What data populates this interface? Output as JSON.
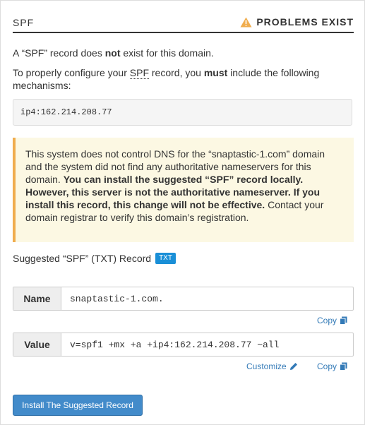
{
  "header": {
    "title": "SPF",
    "status": "PROBLEMS EXIST"
  },
  "intro": {
    "part1": "A “SPF” record does ",
    "bold": "not",
    "part2": " exist for this domain."
  },
  "instruction": {
    "part1": "To properly configure your ",
    "spf": "SPF",
    "part2": " record, you ",
    "bold": "must",
    "part3": " include the following mechanisms:"
  },
  "mechanisms": "ip4:162.214.208.77",
  "alert": {
    "part1": "This system does not control DNS for the “snaptastic-1.com” domain and the system did not find any authoritative nameservers for this domain. ",
    "bold": "You can install the suggested “SPF” record locally. However, this server is not the authoritative nameserver. If you install this record, this change will not be effective.",
    "part2": " Contact your domain registrar to verify this domain’s registration."
  },
  "suggested": {
    "label": "Suggested “SPF” (TXT) Record",
    "badge": "TXT"
  },
  "name_field": {
    "label": "Name",
    "value": "snaptastic-1.com."
  },
  "value_field": {
    "label": "Value",
    "value": "v=spf1 +mx +a +ip4:162.214.208.77 ~all"
  },
  "links": {
    "copy_name": "Copy",
    "customize": "Customize",
    "copy_value": "Copy"
  },
  "install_button": "Install The Suggested Record",
  "colors": {
    "accent": "#428bca",
    "link": "#337ab7",
    "warning": "#f0ad4e",
    "alert_bg": "#fcf8e3",
    "badge": "#1a8fd7"
  },
  "icons": {
    "status": "warning-triangle-icon",
    "copy": "copy-icon",
    "customize": "pencil-icon"
  }
}
